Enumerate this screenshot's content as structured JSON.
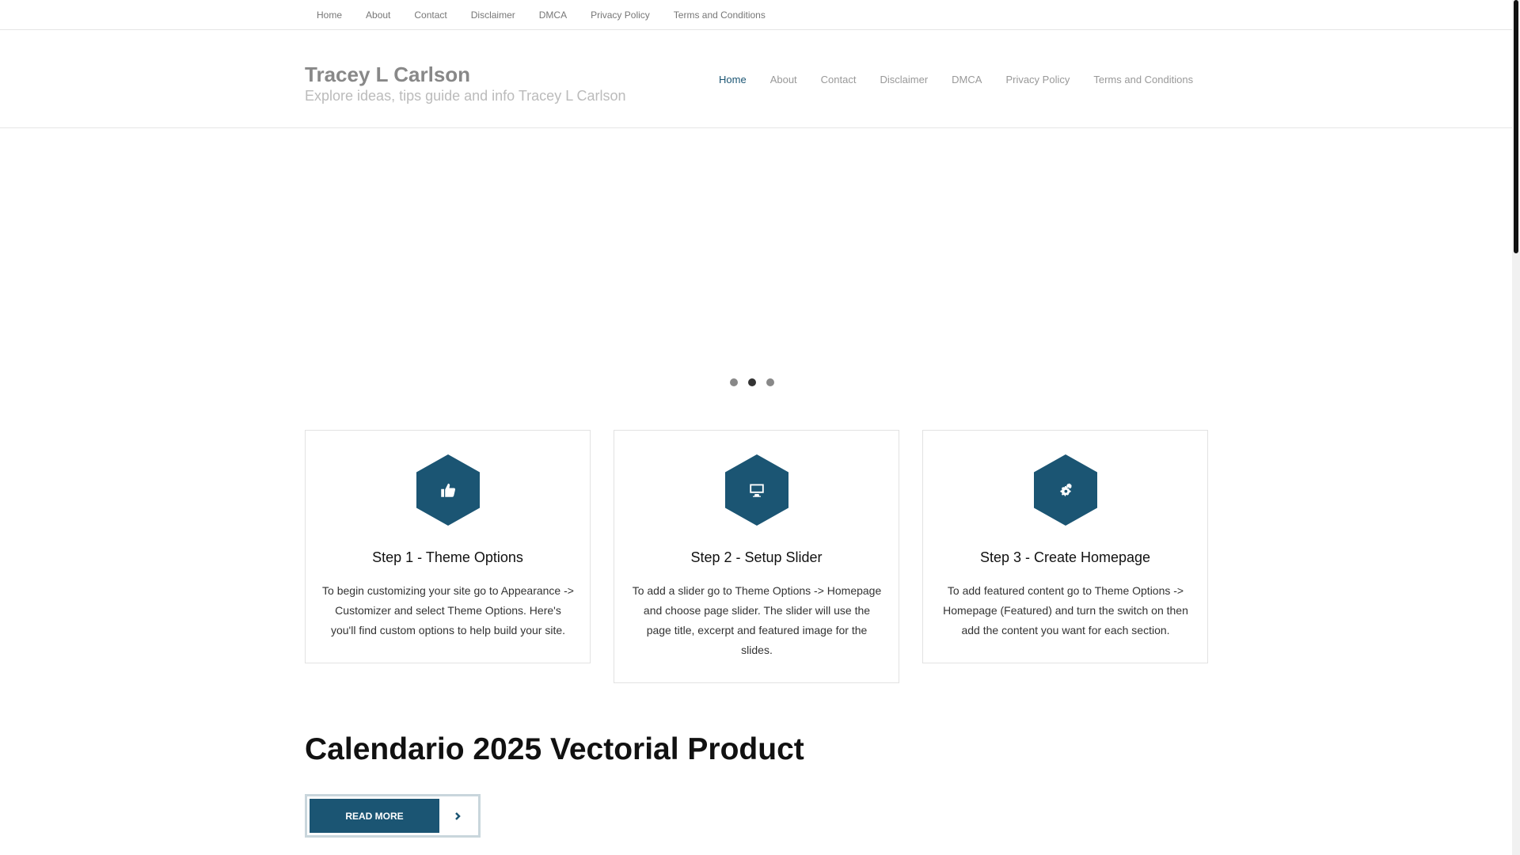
{
  "topbar": {
    "items": [
      "Home",
      "About",
      "Contact",
      "Disclaimer",
      "DMCA",
      "Privacy Policy",
      "Terms and Conditions"
    ]
  },
  "header": {
    "title": "Tracey L Carlson",
    "tagline": "Explore ideas, tips guide and info Tracey L Carlson"
  },
  "mainnav": {
    "items": [
      "Home",
      "About",
      "Contact",
      "Disclaimer",
      "DMCA",
      "Privacy Policy",
      "Terms and Conditions"
    ],
    "active": "Home"
  },
  "slider": {
    "dot_count": 3,
    "active_dot": 2
  },
  "features": [
    {
      "icon": "thumbs-up-icon",
      "title": "Step 1 - Theme Options",
      "text": "To begin customizing your site go to Appearance -> Customizer and select Theme Options. Here's you'll find custom options to help build your site."
    },
    {
      "icon": "desktop-icon",
      "title": "Step 2 - Setup Slider",
      "text": "To add a slider go to Theme Options -> Homepage and choose page slider. The slider will use the page title, excerpt and featured image for the slides."
    },
    {
      "icon": "gears-icon",
      "title": "Step 3 - Create Homepage",
      "text": "To add featured content go to Theme Options -> Homepage (Featured) and turn the switch on then add the content you want for each section."
    }
  ],
  "post": {
    "title": "Calendario 2025 Vectorial Product",
    "read_more": "READ MORE"
  },
  "colors": {
    "accent": "#1b5573"
  }
}
